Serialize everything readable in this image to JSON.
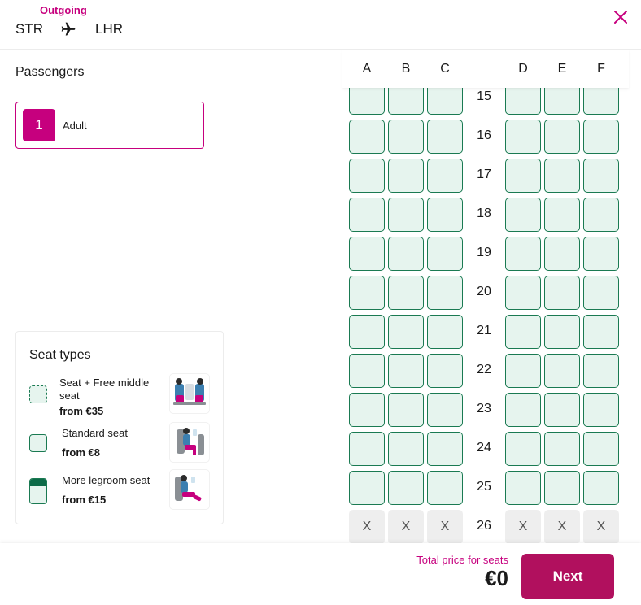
{
  "header": {
    "direction": "Outgoing",
    "origin": "STR",
    "destination": "LHR"
  },
  "passengers": {
    "title": "Passengers",
    "list": [
      {
        "number": "1",
        "label": "Adult"
      }
    ]
  },
  "seat_types": {
    "title": "Seat types",
    "items": [
      {
        "name": "Seat + Free middle seat",
        "price": "from €35",
        "swatch": "dashed"
      },
      {
        "name": "Standard seat",
        "price": "from €8",
        "swatch": "solid"
      },
      {
        "name": "More legroom seat",
        "price": "from €15",
        "swatch": "legroom"
      }
    ]
  },
  "seatmap": {
    "columns_left": [
      "A",
      "B",
      "C"
    ],
    "columns_right": [
      "D",
      "E",
      "F"
    ],
    "rows": [
      {
        "number": "15",
        "seats": [
          "available",
          "available",
          "available",
          "available",
          "available",
          "available"
        ]
      },
      {
        "number": "16",
        "seats": [
          "available",
          "available",
          "available",
          "available",
          "available",
          "available"
        ]
      },
      {
        "number": "17",
        "seats": [
          "available",
          "available",
          "available",
          "available",
          "available",
          "available"
        ]
      },
      {
        "number": "18",
        "seats": [
          "available",
          "available",
          "available",
          "available",
          "available",
          "available"
        ]
      },
      {
        "number": "19",
        "seats": [
          "available",
          "available",
          "available",
          "available",
          "available",
          "available"
        ]
      },
      {
        "number": "20",
        "seats": [
          "available",
          "available",
          "available",
          "available",
          "available",
          "available"
        ]
      },
      {
        "number": "21",
        "seats": [
          "available",
          "available",
          "available",
          "available",
          "available",
          "available"
        ]
      },
      {
        "number": "22",
        "seats": [
          "available",
          "available",
          "available",
          "available",
          "available",
          "available"
        ]
      },
      {
        "number": "23",
        "seats": [
          "available",
          "available",
          "available",
          "available",
          "available",
          "available"
        ]
      },
      {
        "number": "24",
        "seats": [
          "available",
          "available",
          "available",
          "available",
          "available",
          "available"
        ]
      },
      {
        "number": "25",
        "seats": [
          "available",
          "available",
          "available",
          "available",
          "available",
          "available"
        ]
      },
      {
        "number": "26",
        "seats": [
          "unavailable",
          "unavailable",
          "unavailable",
          "unavailable",
          "unavailable",
          "unavailable"
        ]
      }
    ],
    "unavailable_mark": "X"
  },
  "footer": {
    "total_label": "Total price for seats",
    "total_value": "€0",
    "next_label": "Next"
  },
  "colors": {
    "brand": "#c6007e",
    "next_button": "#b1105e",
    "seat_border": "#1a7a52",
    "seat_fill": "#e6f4ee",
    "seat_unavailable": "#eeeeee"
  },
  "icons": {
    "route": "plane-icon",
    "close": "close-icon"
  }
}
